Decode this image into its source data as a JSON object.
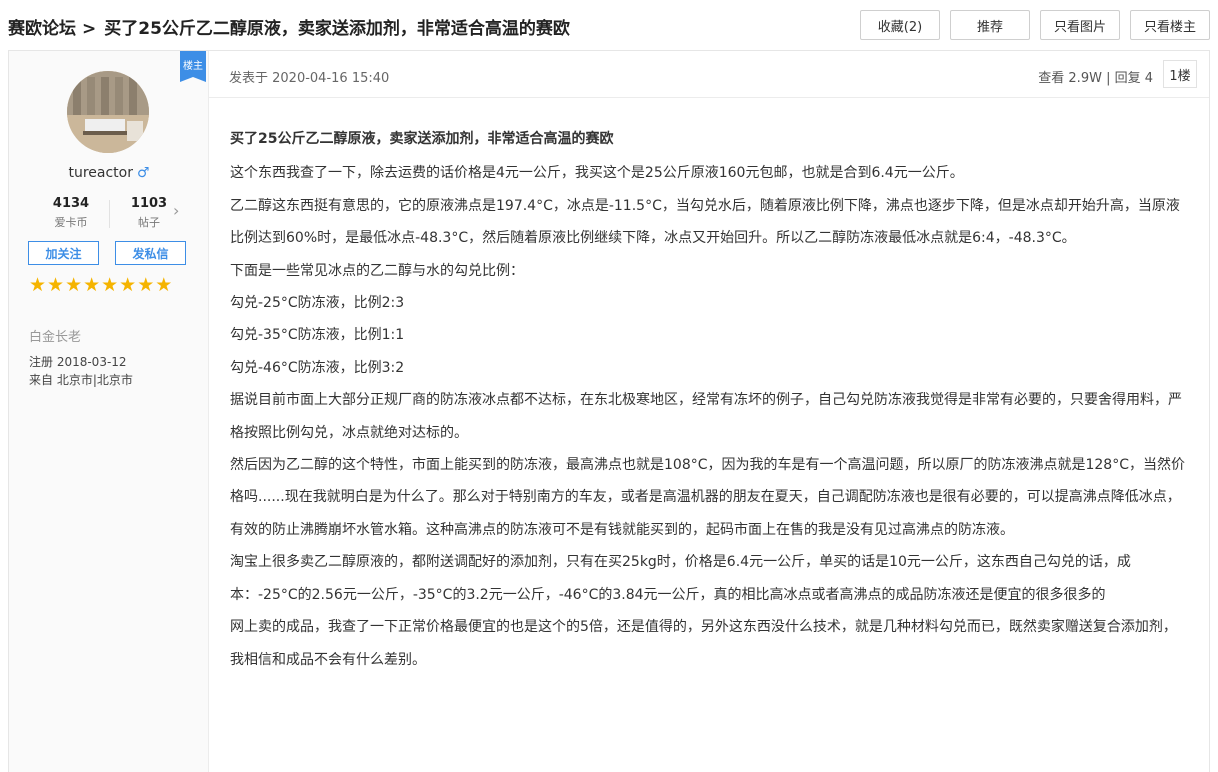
{
  "header": {
    "forum_name": "赛欧论坛",
    "separator": ">",
    "thread_title": "买了25公斤乙二醇原液，卖家送添加剂，非常适合高温的赛欧",
    "buttons": [
      "收藏(2)",
      "推荐",
      "只看图片",
      "只看楼主"
    ]
  },
  "author": {
    "host_badge": "楼主",
    "username": "tureactor",
    "gender_icon": "♂",
    "coins": "4134",
    "coins_label": "爱卡币",
    "posts": "1103",
    "posts_label": "帖子",
    "follow_label": "加关注",
    "message_label": "发私信",
    "stars": "★★★★★★★★",
    "rank": "白金长老",
    "registered": "注册 2018-03-12",
    "location": "来自 北京市|北京市"
  },
  "post": {
    "published": "发表于 2020-04-16 15:40",
    "views": "查看 2.9W | 回复 4",
    "floor": "1楼",
    "title": "买了25公斤乙二醇原液，卖家送添加剂，非常适合高温的赛欧",
    "paragraphs": [
      "这个东西我查了一下，除去运费的话价格是4元一公斤，我买这个是25公斤原液160元包邮，也就是合到6.4元一公斤。",
      "乙二醇这东西挺有意思的，它的原液沸点是197.4°C，冰点是-11.5°C，当勾兑水后，随着原液比例下降，沸点也逐步下降，但是冰点却开始升高，当原液比例达到60%时，是最低冰点-48.3°C，然后随着原液比例继续下降，冰点又开始回升。所以乙二醇防冻液最低冰点就是6:4，-48.3°C。",
      "下面是一些常见冰点的乙二醇与水的勾兑比例：",
      "勾兑-25°C防冻液，比例2:3",
      "勾兑-35°C防冻液，比例1:1",
      "勾兑-46°C防冻液，比例3:2",
      "据说目前市面上大部分正规厂商的防冻液冰点都不达标，在东北极寒地区，经常有冻坏的例子，自己勾兑防冻液我觉得是非常有必要的，只要舍得用料，严格按照比例勾兑，冰点就绝对达标的。",
      "然后因为乙二醇的这个特性，市面上能买到的防冻液，最高沸点也就是108°C，因为我的车是有一个高温问题，所以原厂的防冻液沸点就是128°C，当然价格吗......现在我就明白是为什么了。那么对于特别南方的车友，或者是高温机器的朋友在夏天，自己调配防冻液也是很有必要的，可以提高沸点降低冰点，有效的防止沸腾崩坏水管水箱。这种高沸点的防冻液可不是有钱就能买到的，起码市面上在售的我是没有见过高沸点的防冻液。",
      "淘宝上很多卖乙二醇原液的，都附送调配好的添加剂，只有在买25kg时，价格是6.4元一公斤，单买的话是10元一公斤，这东西自己勾兑的话，成本：-25°C的2.56元一公斤，-35°C的3.2元一公斤，-46°C的3.84元一公斤，真的相比高冰点或者高沸点的成品防冻液还是便宜的很多很多的",
      "网上卖的成品，我查了一下正常价格最便宜的也是这个的5倍，还是值得的，另外这东西没什么技术，就是几种材料勾兑而已，既然卖家赠送复合添加剂，我相信和成品不会有什么差别。"
    ]
  }
}
